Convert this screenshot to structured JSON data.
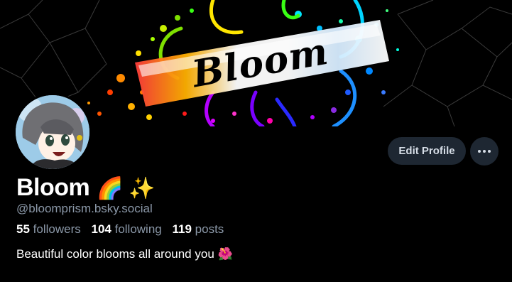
{
  "banner": {
    "logo_text": "Bloom"
  },
  "profile": {
    "display_name": "Bloom",
    "name_emoji": "🌈 ✨",
    "handle": "@bloomprism.bsky.social",
    "bio": "Beautiful color blooms all around you 🌺"
  },
  "stats": {
    "followers_count": "55",
    "followers_label": "followers",
    "following_count": "104",
    "following_label": "following",
    "posts_count": "119",
    "posts_label": "posts"
  },
  "actions": {
    "edit_label": "Edit Profile",
    "more_label": "···"
  },
  "colors": {
    "background": "#000000",
    "button_bg": "#1e2732",
    "muted_text": "#8b98a8"
  }
}
